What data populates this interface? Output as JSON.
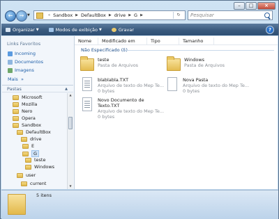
{
  "address": {
    "crumbs": [
      "Sandbox",
      "DefaultBox",
      "drive",
      "G"
    ]
  },
  "search": {
    "placeholder": "Pesquisar"
  },
  "toolbar": {
    "organize": "Organizar",
    "views": "Modos de exibição",
    "burn": "Gravar"
  },
  "favorites": {
    "title": "Links Favoritos",
    "items": [
      "Incoming",
      "Documentos",
      "Imagens"
    ],
    "more": "Mais"
  },
  "folders": {
    "title": "Pastas",
    "tree": [
      "Microsoft",
      "Mozilla",
      "Nero",
      "Opera",
      "Sandbox",
      "DefaultBox",
      "drive",
      "E",
      "G",
      "teste",
      "Windows",
      "user",
      "current"
    ]
  },
  "columns": [
    "Nome",
    "Modificado em",
    "Tipo",
    "Tamanho"
  ],
  "group": {
    "label": "Não Especificado (5)"
  },
  "items": [
    {
      "name": "teste",
      "sub": "Pasta de Arquivos",
      "size": ""
    },
    {
      "name": "Windows",
      "sub": "Pasta de Arquivos",
      "size": ""
    },
    {
      "name": "blablabla.TXT",
      "sub": "Arquivo de texto do Mep Te...",
      "size": "0 bytes"
    },
    {
      "name": "Nova Pasta",
      "sub": "Arquivo de texto do Mep Te...",
      "size": "0 bytes"
    },
    {
      "name": "Novo Documento de",
      "name2": "Texto.TXT",
      "sub": "Arquivo de texto do Mep Te...",
      "size": "0 bytes"
    }
  ],
  "status": {
    "count": "5 itens"
  },
  "colors": {
    "toolbar": "#3a5a7e",
    "link": "#1d5ea8",
    "folder": "#e4bc52"
  }
}
